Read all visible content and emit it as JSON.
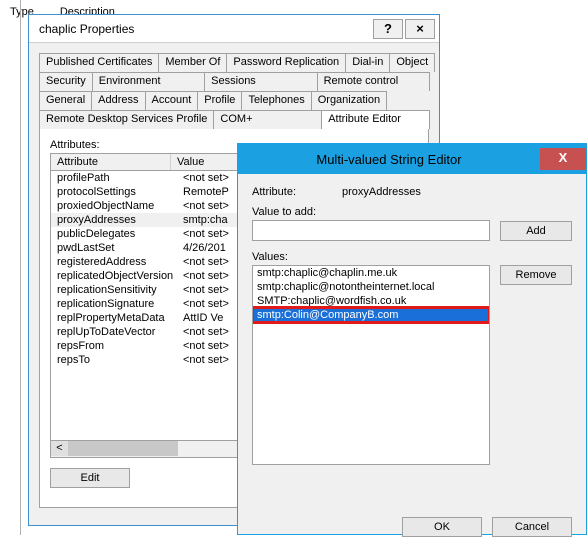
{
  "background": {
    "col1": "Type",
    "col2": "Description"
  },
  "propwin": {
    "title": "chaplic Properties",
    "help": "?",
    "close": "×",
    "tabs": {
      "r1": [
        "Published Certificates",
        "Member Of",
        "Password Replication",
        "Dial-in",
        "Object"
      ],
      "r2": [
        "Security",
        "Environment",
        "Sessions",
        "Remote control"
      ],
      "r3": [
        "General",
        "Address",
        "Account",
        "Profile",
        "Telephones",
        "Organization"
      ],
      "r4": [
        "Remote Desktop Services Profile",
        "COM+",
        "Attribute Editor"
      ]
    },
    "attributes_label": "Attributes:",
    "columns": {
      "attr": "Attribute",
      "val": "Value"
    },
    "rows": [
      {
        "a": "profilePath",
        "v": "<not set>"
      },
      {
        "a": "protocolSettings",
        "v": "RemoteP"
      },
      {
        "a": "proxiedObjectName",
        "v": "<not set>"
      },
      {
        "a": "proxyAddresses",
        "v": "smtp:cha"
      },
      {
        "a": "publicDelegates",
        "v": "<not set>"
      },
      {
        "a": "pwdLastSet",
        "v": "4/26/201"
      },
      {
        "a": "registeredAddress",
        "v": "<not set>"
      },
      {
        "a": "replicatedObjectVersion",
        "v": "<not set>"
      },
      {
        "a": "replicationSensitivity",
        "v": "<not set>"
      },
      {
        "a": "replicationSignature",
        "v": "<not set>"
      },
      {
        "a": "replPropertyMetaData",
        "v": "AttID  Ve"
      },
      {
        "a": "replUpToDateVector",
        "v": "<not set>"
      },
      {
        "a": "repsFrom",
        "v": "<not set>"
      },
      {
        "a": "repsTo",
        "v": "<not set>"
      }
    ],
    "scroll": {
      "left": "<",
      "right": ">"
    },
    "edit_btn": "Edit"
  },
  "strwin": {
    "title": "Multi-valued String Editor",
    "close": "X",
    "attribute_label": "Attribute:",
    "attribute_value": "proxyAddresses",
    "value_to_add_label": "Value to add:",
    "value_to_add": "",
    "add_btn": "Add",
    "values_label": "Values:",
    "values": [
      "smtp:chaplic@chaplin.me.uk",
      "smtp:chaplic@notontheinternet.local",
      "SMTP:chaplic@wordfish.co.uk",
      "smtp:Colin@CompanyB.com"
    ],
    "remove_btn": "Remove",
    "ok_btn": "OK",
    "cancel_btn": "Cancel"
  }
}
